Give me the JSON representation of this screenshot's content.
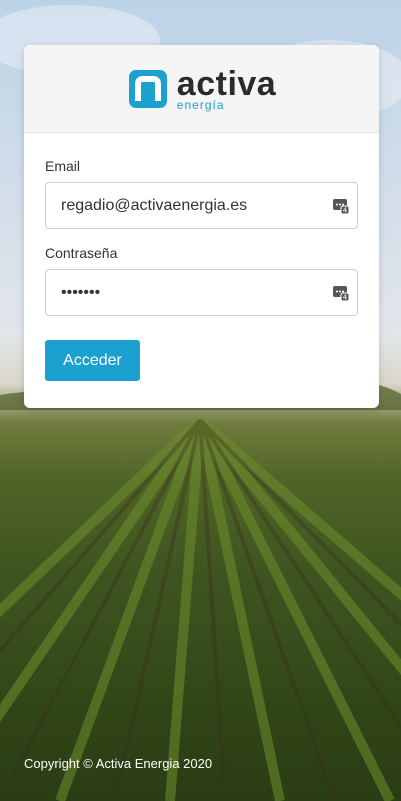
{
  "brand": {
    "name": "activa",
    "sub": "energía",
    "logo_icon": "activa-logo-icon",
    "accent_color": "#1ba1d0"
  },
  "form": {
    "email_label": "Email",
    "email_value": "regadio@activaenergia.es",
    "password_label": "Contraseña",
    "password_value": "•••••••",
    "submit_label": "Acceder",
    "field_icon": "password-manager-icon"
  },
  "footer": {
    "copyright": "Copyright © Activa Energia 2020"
  }
}
